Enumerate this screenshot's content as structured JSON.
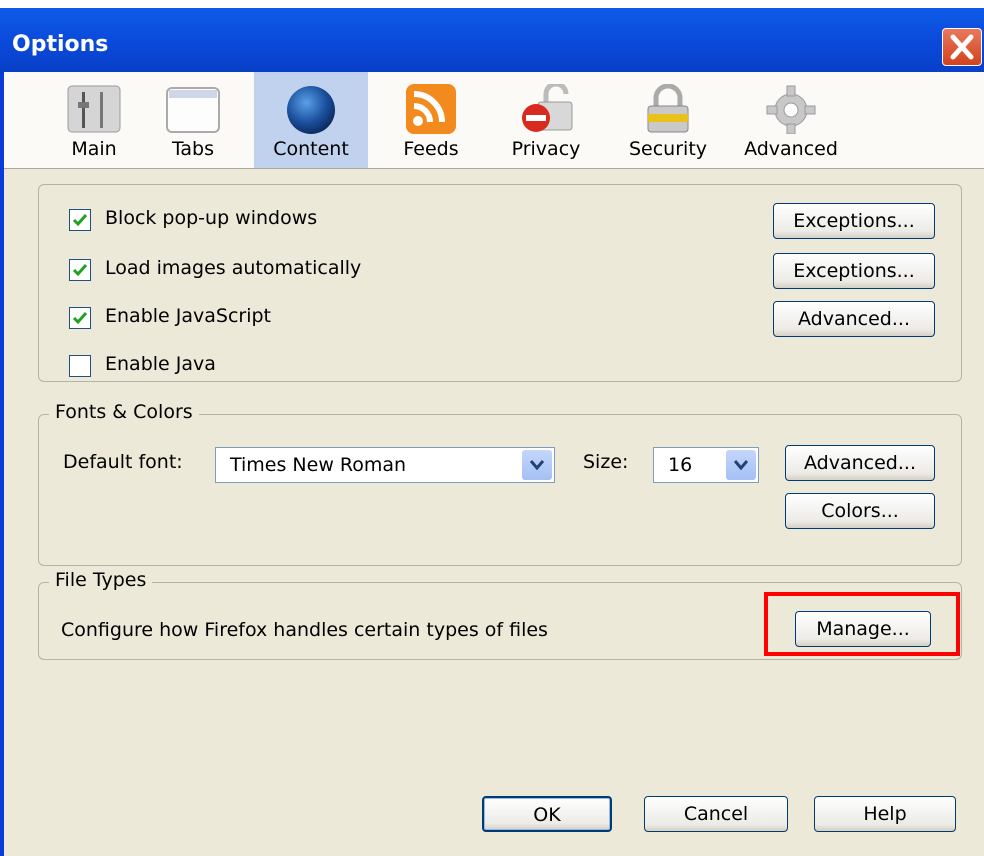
{
  "window": {
    "title": "Options"
  },
  "toolbar": {
    "items": [
      {
        "label": "Main",
        "icon": "main-slider-icon"
      },
      {
        "label": "Tabs",
        "icon": "tabs-window-icon"
      },
      {
        "label": "Content",
        "icon": "globe-icon",
        "selected": true
      },
      {
        "label": "Feeds",
        "icon": "rss-feed-icon"
      },
      {
        "label": "Privacy",
        "icon": "privacy-lock-icon"
      },
      {
        "label": "Security",
        "icon": "padlock-icon"
      },
      {
        "label": "Advanced",
        "icon": "gear-icon"
      }
    ]
  },
  "content": {
    "block_popups": {
      "label": "Block pop-up windows",
      "checked": true,
      "button": "Exceptions..."
    },
    "load_images": {
      "label": "Load images automatically",
      "checked": true,
      "button": "Exceptions..."
    },
    "enable_js": {
      "label": "Enable JavaScript",
      "checked": true,
      "button": "Advanced..."
    },
    "enable_java": {
      "label": "Enable Java",
      "checked": false
    }
  },
  "fonts": {
    "legend": "Fonts & Colors",
    "default_font_label": "Default font:",
    "default_font_value": "Times New Roman",
    "size_label": "Size:",
    "size_value": "16",
    "advanced_button": "Advanced...",
    "colors_button": "Colors..."
  },
  "file_types": {
    "legend": "File Types",
    "description": "Configure how Firefox handles certain types of files",
    "manage_button": "Manage..."
  },
  "footer": {
    "ok": "OK",
    "cancel": "Cancel",
    "help": "Help"
  },
  "colors": {
    "highlight": "#ff0000",
    "titlebar": "#0a49d9",
    "selected_tab": "#c1d2ee"
  }
}
